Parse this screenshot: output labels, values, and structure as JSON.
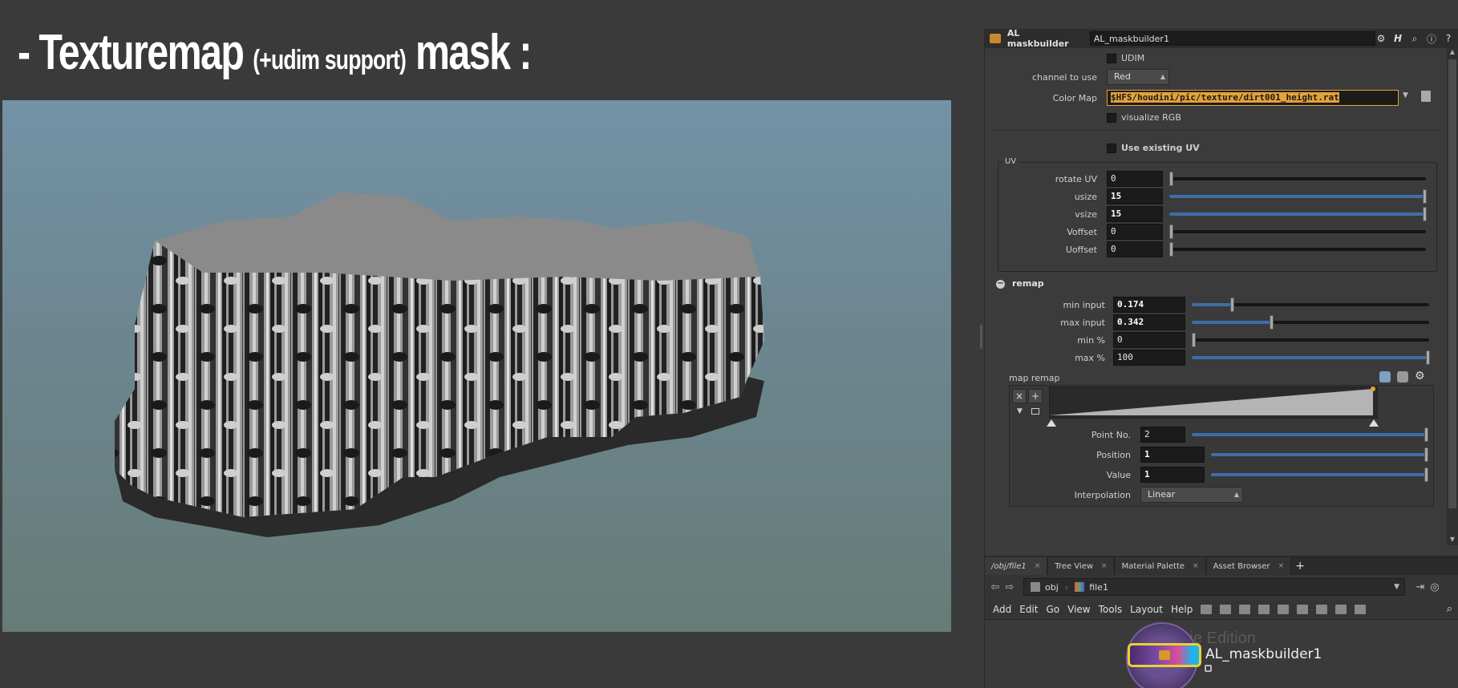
{
  "slide": {
    "title_prefix": "- Texturemap",
    "title_small": "(+udim support)",
    "title_suffix": "mask :"
  },
  "parameter_editor": {
    "node_type": "AL maskbuilder",
    "node_name": "AL_maskbuilder1",
    "udim_label": "UDIM",
    "channel_label": "channel to use",
    "channel_value": "Red",
    "colormap_label": "Color Map",
    "colormap_value": "$HFS/houdini/pic/texture/dirt001_height.rat",
    "visualize_label": "visualize RGB",
    "use_existing_uv_label": "Use existing UV",
    "uv_group_label": "UV",
    "uv_params": [
      {
        "label": "rotate UV",
        "value": "0",
        "fraction": 0.0
      },
      {
        "label": "usize",
        "value": "15",
        "fraction": 1.0
      },
      {
        "label": "vsize",
        "value": "15",
        "fraction": 1.0
      },
      {
        "label": "Voffset",
        "value": "0",
        "fraction": 0.0
      },
      {
        "label": "Uoffset",
        "value": "0",
        "fraction": 0.0
      }
    ],
    "remap_section_label": "remap",
    "remap_params": [
      {
        "label": "min input",
        "value": "0.174",
        "fraction": 0.174
      },
      {
        "label": "max input",
        "value": "0.342",
        "fraction": 0.342
      },
      {
        "label": "min %",
        "value": "0",
        "fraction": 0.0
      },
      {
        "label": "max %",
        "value": "100",
        "fraction": 1.0
      }
    ],
    "map_remap_label": "map remap",
    "ramp": {
      "point_no_label": "Point No.",
      "point_no_value": "2",
      "position_label": "Position",
      "position_value": "1",
      "value_label": "Value",
      "value_value": "1",
      "interpolation_label": "Interpolation",
      "interpolation_value": "Linear"
    }
  },
  "pane_tabs": [
    {
      "label": "/obj/file1",
      "active": true
    },
    {
      "label": "Tree View",
      "active": false
    },
    {
      "label": "Material Palette",
      "active": false
    },
    {
      "label": "Asset Browser",
      "active": false
    }
  ],
  "path": {
    "root": "obj",
    "node": "file1"
  },
  "menu": [
    "Add",
    "Edit",
    "Go",
    "View",
    "Tools",
    "Layout",
    "Help"
  ],
  "network": {
    "watermark": "tie Edition",
    "node_label": "AL_maskbuilder1"
  },
  "colors": {
    "accent_blue": "#3d6ea8",
    "node_outline": "#e8d233",
    "highlight_field": "#e4a23a"
  }
}
